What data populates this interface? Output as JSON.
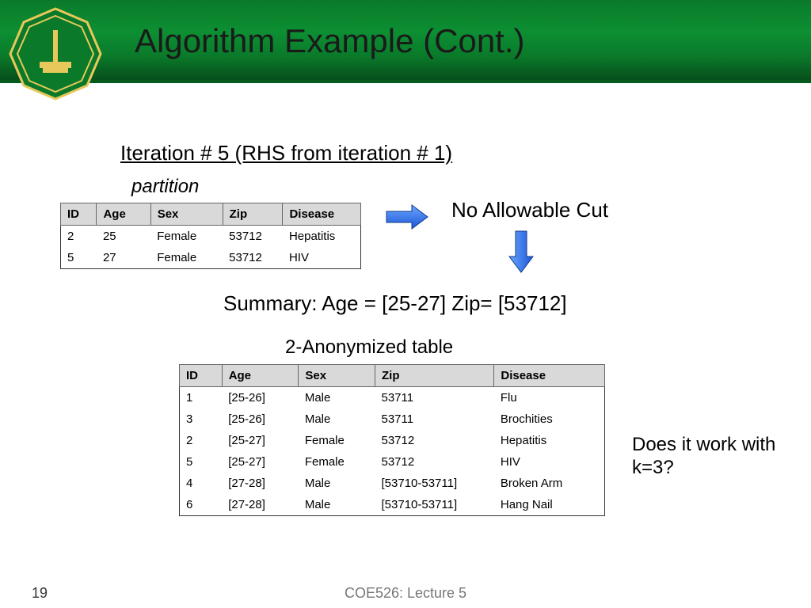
{
  "header": {
    "title": "Algorithm Example (Cont.)"
  },
  "iter_heading": "Iteration # 5 (RHS from iteration # 1)",
  "partition_label": "partition",
  "no_cut": "No Allowable Cut",
  "summary": "Summary: Age = [25-27]    Zip= [53712]",
  "anon_label": "2-Anonymized table",
  "question": "Does it work with k=3?",
  "footer": {
    "left": "19",
    "center": "COE526: Lecture 5"
  },
  "table1": {
    "headers": [
      "ID",
      "Age",
      "Sex",
      "Zip",
      "Disease"
    ],
    "rows": [
      [
        "2",
        "25",
        "Female",
        "53712",
        "Hepatitis"
      ],
      [
        "5",
        "27",
        "Female",
        "53712",
        "HIV"
      ]
    ]
  },
  "table2": {
    "headers": [
      "ID",
      "Age",
      "Sex",
      "Zip",
      "Disease"
    ],
    "rows": [
      [
        "1",
        "[25-26]",
        "Male",
        "53711",
        "Flu"
      ],
      [
        "3",
        "[25-26]",
        "Male",
        "53711",
        "Brochities"
      ],
      [
        "2",
        "[25-27]",
        "Female",
        "53712",
        "Hepatitis"
      ],
      [
        "5",
        "[25-27]",
        "Female",
        "53712",
        "HIV"
      ],
      [
        "4",
        "[27-28]",
        "Male",
        "[53710-53711]",
        "Broken Arm"
      ],
      [
        "6",
        "[27-28]",
        "Male",
        "[53710-53711]",
        "Hang Nail"
      ]
    ]
  }
}
